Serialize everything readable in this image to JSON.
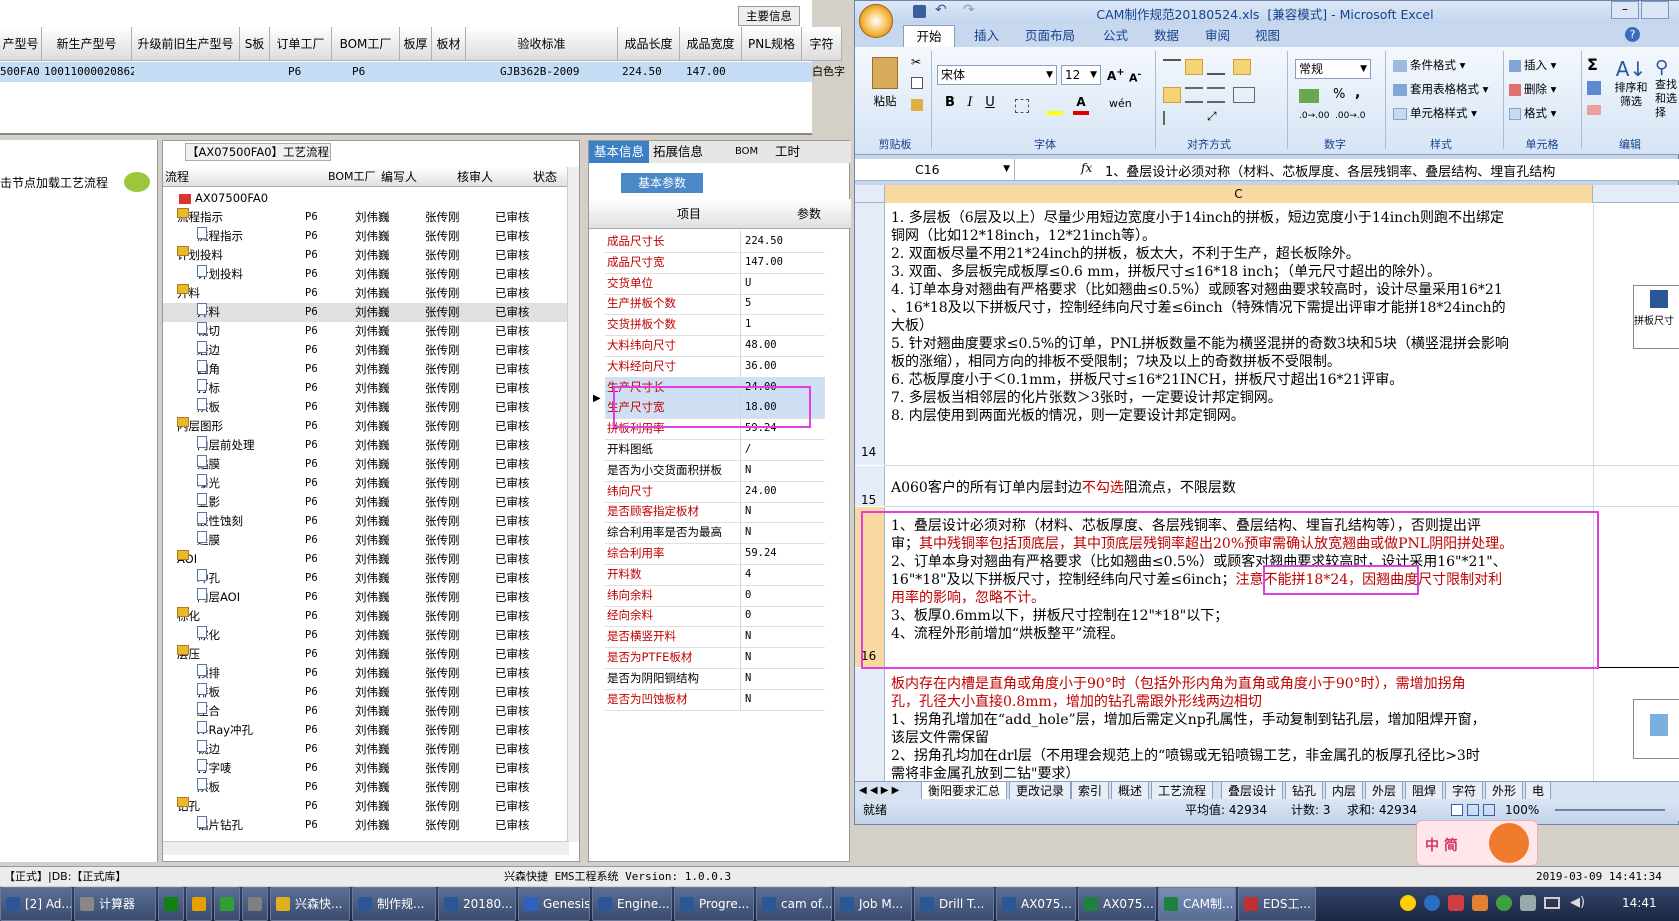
{
  "top_grid": {
    "top_button": "主要信息",
    "headers": [
      "产型号",
      "新生产型号",
      "升级前旧生产型号",
      "S板",
      "订单工厂",
      "BOM工厂",
      "板厚",
      "板材",
      "验收标准",
      "成品长度",
      "成品宽度",
      "PNL规格",
      "字符"
    ],
    "row": [
      "500FA0",
      "10011000020862",
      "",
      "",
      "P6",
      "P6",
      "",
      "",
      "GJB362B-2009",
      "224.50",
      "147.00",
      "",
      "白色字"
    ]
  },
  "left_panel": {
    "hint": "击节点加载工艺流程"
  },
  "process": {
    "title": "【AX07500FA0】工艺流程",
    "headers": [
      "流程",
      "BOM工厂",
      "编写人",
      "核审人",
      "状态"
    ],
    "root": "AX07500FA0",
    "rows": [
      {
        "name": "流程指示",
        "level": 1,
        "f": "P6",
        "w": "刘伟巍",
        "r": "张传刚",
        "s": "已审核"
      },
      {
        "name": "流程指示",
        "level": 2,
        "f": "P6",
        "w": "刘伟巍",
        "r": "张传刚",
        "s": "已审核"
      },
      {
        "name": "计划投料",
        "level": 1,
        "f": "P6",
        "w": "刘伟巍",
        "r": "张传刚",
        "s": "已审核"
      },
      {
        "name": "计划投料",
        "level": 2,
        "f": "P6",
        "w": "刘伟巍",
        "r": "张传刚",
        "s": "已审核"
      },
      {
        "name": "开料",
        "level": 1,
        "f": "P6",
        "w": "刘伟巍",
        "r": "张传刚",
        "s": "已审核"
      },
      {
        "name": "开料",
        "level": 2,
        "f": "P6",
        "w": "刘伟巍",
        "r": "张传刚",
        "s": "已审核"
      },
      {
        "name": "裁切",
        "level": 2,
        "f": "P6",
        "w": "刘伟巍",
        "r": "张传刚",
        "s": "已审核"
      },
      {
        "name": "磨边",
        "level": 2,
        "f": "P6",
        "w": "刘伟巍",
        "r": "张传刚",
        "s": "已审核"
      },
      {
        "name": "圆角",
        "level": 2,
        "f": "P6",
        "w": "刘伟巍",
        "r": "张传刚",
        "s": "已审核"
      },
      {
        "name": "打标",
        "level": 2,
        "f": "P6",
        "w": "刘伟巍",
        "r": "张传刚",
        "s": "已审核"
      },
      {
        "name": "烘板",
        "level": 2,
        "f": "P6",
        "w": "刘伟巍",
        "r": "张传刚",
        "s": "已审核"
      },
      {
        "name": "内层图形",
        "level": 1,
        "f": "P6",
        "w": "刘伟巍",
        "r": "张传刚",
        "s": "已审核"
      },
      {
        "name": "内层前处理",
        "level": 2,
        "f": "P6",
        "w": "刘伟巍",
        "r": "张传刚",
        "s": "已审核"
      },
      {
        "name": "贴膜",
        "level": 2,
        "f": "P6",
        "w": "刘伟巍",
        "r": "张传刚",
        "s": "已审核"
      },
      {
        "name": "曝光",
        "level": 2,
        "f": "P6",
        "w": "刘伟巍",
        "r": "张传刚",
        "s": "已审核"
      },
      {
        "name": "显影",
        "level": 2,
        "f": "P6",
        "w": "刘伟巍",
        "r": "张传刚",
        "s": "已审核"
      },
      {
        "name": "酸性蚀刻",
        "level": 2,
        "f": "P6",
        "w": "刘伟巍",
        "r": "张传刚",
        "s": "已审核"
      },
      {
        "name": "退膜",
        "level": 2,
        "f": "P6",
        "w": "刘伟巍",
        "r": "张传刚",
        "s": "已审核"
      },
      {
        "name": "AOI",
        "level": 1,
        "f": "P6",
        "w": "刘伟巍",
        "r": "张传刚",
        "s": "已审核"
      },
      {
        "name": "冲孔",
        "level": 2,
        "f": "P6",
        "w": "刘伟巍",
        "r": "张传刚",
        "s": "已审核"
      },
      {
        "name": "内层AOI",
        "level": 2,
        "f": "P6",
        "w": "刘伟巍",
        "r": "张传刚",
        "s": "已审核"
      },
      {
        "name": "棕化",
        "level": 1,
        "f": "P6",
        "w": "刘伟巍",
        "r": "张传刚",
        "s": "已审核"
      },
      {
        "name": "棕化",
        "level": 2,
        "f": "P6",
        "w": "刘伟巍",
        "r": "张传刚",
        "s": "已审核"
      },
      {
        "name": "层压",
        "level": 1,
        "f": "P6",
        "w": "刘伟巍",
        "r": "张传刚",
        "s": "已审核"
      },
      {
        "name": "预排",
        "level": 2,
        "f": "P6",
        "w": "刘伟巍",
        "r": "张传刚",
        "s": "已审核"
      },
      {
        "name": "排板",
        "level": 2,
        "f": "P6",
        "w": "刘伟巍",
        "r": "张传刚",
        "s": "已审核"
      },
      {
        "name": "压合",
        "level": 2,
        "f": "P6",
        "w": "刘伟巍",
        "r": "张传刚",
        "s": "已审核"
      },
      {
        "name": "X-Ray冲孔",
        "level": 2,
        "f": "P6",
        "w": "刘伟巍",
        "r": "张传刚",
        "s": "已审核"
      },
      {
        "name": "铣边",
        "level": 2,
        "f": "P6",
        "w": "刘伟巍",
        "r": "张传刚",
        "s": "已审核"
      },
      {
        "name": "打字唛",
        "level": 2,
        "f": "P6",
        "w": "刘伟巍",
        "r": "张传刚",
        "s": "已审核"
      },
      {
        "name": "烘板",
        "level": 2,
        "f": "P6",
        "w": "刘伟巍",
        "r": "张传刚",
        "s": "已审核"
      },
      {
        "name": "钻孔",
        "level": 1,
        "f": "P6",
        "w": "刘伟巍",
        "r": "张传刚",
        "s": "已审核"
      },
      {
        "name": "铝片钻孔",
        "level": 2,
        "f": "P6",
        "w": "刘伟巍",
        "r": "张传刚",
        "s": "已审核"
      }
    ]
  },
  "params": {
    "tabs": [
      "基本信息",
      "拓展信息",
      "BOM",
      "工时"
    ],
    "subtab": "基本参数",
    "col_item": "项目",
    "col_value": "参数",
    "rows": [
      {
        "name": "成品尺寸长",
        "value": "224.50",
        "red": true
      },
      {
        "name": "成品尺寸宽",
        "value": "147.00",
        "red": true
      },
      {
        "name": "交货单位",
        "value": "U",
        "red": true
      },
      {
        "name": "生产拼板个数",
        "value": "5",
        "red": true
      },
      {
        "name": "交货拼板个数",
        "value": "1",
        "red": true
      },
      {
        "name": "大料纬向尺寸",
        "value": "48.00",
        "red": true
      },
      {
        "name": "大料经向尺寸",
        "value": "36.00",
        "red": true
      },
      {
        "name": "生产尺寸长",
        "value": "24.00",
        "red": true
      },
      {
        "name": "生产尺寸宽",
        "value": "18.00",
        "red": true
      },
      {
        "name": "拼板利用率",
        "value": "59.24",
        "red": true
      },
      {
        "name": "开料图纸",
        "value": "/",
        "red": false
      },
      {
        "name": "是否为小交货面积拼板",
        "value": "N",
        "red": false
      },
      {
        "name": "纬向尺寸",
        "value": "24.00",
        "red": true
      },
      {
        "name": "是否顾客指定板材",
        "value": "N",
        "red": true
      },
      {
        "name": "综合利用率是否为最高",
        "value": "N",
        "red": false
      },
      {
        "name": "综合利用率",
        "value": "59.24",
        "red": true
      },
      {
        "name": "开料数",
        "value": "4",
        "red": true
      },
      {
        "name": "纬向余料",
        "value": "0",
        "red": true
      },
      {
        "name": "经向余料",
        "value": "0",
        "red": true
      },
      {
        "name": "是否横竖开料",
        "value": "N",
        "red": true
      },
      {
        "name": "是否为PTFE板材",
        "value": "N",
        "red": true
      },
      {
        "name": "是否为阴阳铜结构",
        "value": "N",
        "red": false
      },
      {
        "name": "是否为凹蚀板材",
        "value": "N",
        "red": true
      }
    ]
  },
  "status_bar": {
    "left": "【正式】|DB:【正式库】",
    "center": "兴森快捷 EMS工程系统 Version: 1.0.0.3",
    "datetime": "2019-03-09 14:41:34"
  },
  "excel": {
    "title": "CAM制作规范20180524.xls  [兼容模式] - Microsoft Excel",
    "ribbon_tabs": [
      "开始",
      "插入",
      "页面布局",
      "公式",
      "数据",
      "审阅",
      "视图"
    ],
    "font_name": "宋体",
    "font_size": "12",
    "number_format": "常规",
    "group_labels": [
      "剪贴板",
      "字体",
      "对齐方式",
      "数字",
      "样式",
      "单元格",
      "编辑"
    ],
    "paste_label": "粘贴",
    "styles": [
      "条件格式",
      "套用表格格式",
      "单元格样式"
    ],
    "cells_btns": [
      "插入",
      "删除",
      "格式"
    ],
    "edit_btns": [
      "排序和筛选",
      "查找和选择"
    ],
    "name_box": "C16",
    "fx": "fx",
    "formula": "1、叠层设计必须对称（材料、芯板厚度、各层残铜率、叠层结构、埋盲孔结构",
    "col_header": "C",
    "row_block1": [
      "1. 多层板（6层及以上）尽量少用短边宽度小于14inch的拼板，短边宽度小于14inch则跑不出绑定",
      "铜网（比如12*18inch，12*21inch等）。",
      "2. 双面板尽量不用21*24inch的拼板，板太大，不利于生产，超长板除外。",
      "3. 双面、多层板完成板厚≤0.6 mm，拼板尺寸≤16*18 inch；（单元尺寸超出的除外）。",
      "4. 订单本身对翘曲有严格要求（比如翘曲≤0.5%）或顾客对翘曲要求较高时，设计尽量采用16*21",
      "、16*18及以下拼板尺寸，控制经纬向尺寸差≤6inch（特殊情况下需提出评审才能拼18*24inch的",
      "大板）",
      "5. 针对翘曲度要求≤0.5%的订单，PNL拼板数量不能为横竖混拼的奇数3块和5块（横竖混拼会影响",
      "板的涨缩），相同方向的排板不受限制；7块及以上的奇数拼板不受限制。",
      "6. 芯板厚度小于＜0.1mm，拼板尺寸≤16*21INCH，拼板尺寸超出16*21评审。",
      "7. 多层板当相邻层的化片张数＞3张时，一定要设计邦定铜网。",
      "8. 内层使用到两面光板的情况，则一定要设计邦定铜网。"
    ],
    "row14": "14",
    "row15": "15",
    "row16": "16",
    "row15_a": "A060客户的所有订单内层封边",
    "row15_b": "不勾选",
    "row15_c": "阻流点，不限层数",
    "row16_l1": "1、叠层设计必须对称（材料、芯板厚度、各层残铜率、叠层结构、埋盲孔结构等），否则提出评",
    "row16_l2a": "审；",
    "row16_l2b": "其中残铜率包括顶底层，其中顶底层残铜率超出20%预审需确认放宽翘曲或做PNL阴阳拼处理。",
    "row16_l3": "2、订单本身对翘曲有严格要求（比如翘曲≤0.5%）或顾客对翘曲要求较高时，设计采用16\"*21\"、",
    "row16_l4a": "16\"*18\"及以下拼板尺寸，控制经纬向尺寸差≤6inch；",
    "row16_l4b": "注意不能拼18*24，",
    "row16_l4c": "因翘曲度尺寸限制对利",
    "row16_l5": "用率的影响，忽略不计。",
    "row16_l6": "3、板厚0.6mm以下，拼板尺寸控制在12\"*18\"以下；",
    "row16_l7": "4、流程外形前增加“烘板整平”流程。",
    "row17_l1": "板内存在内槽是直角或角度小于90°时（包括外形内角为直角或角度小于90°时），需增加拐角",
    "row17_l2": "孔，孔径大小直接0.8mm，增加的钻孔需跟外形线两边相切",
    "row17_l3": "1、拐角孔增加在“add_hole”层，增加后需定义np孔属性，手动复制到钻孔层，增加阻焊开窗，",
    "row17_l4": "该层文件需保留",
    "row17_l5": "2、拐角孔均加在drl层（不用理会规范上的“喷锡或无铅喷锡工艺，非金属孔的板厚孔径比>3时",
    "row17_l6": "需将非金属孔放到二钻\"要求）",
    "side_note": "拼板尺寸",
    "sheet_tabs": [
      "衡阳要求汇总",
      "更改记录",
      "索引",
      "概述",
      "工艺流程",
      "叠层设计",
      "钻孔",
      "内层",
      "外层",
      "阻焊",
      "字符",
      "外形",
      "电"
    ],
    "status_ready": "就绪",
    "status_avg": "平均值: 42934",
    "status_count": "计数: 3",
    "status_sum": "求和: 42934",
    "zoom": "100%"
  },
  "ime": {
    "text": "中 简"
  },
  "taskbar": {
    "items": [
      "[2] Ad...",
      "计算器",
      "",
      "",
      "",
      "",
      "兴森快...",
      "制作规...",
      "20180...",
      "Genesis",
      "Engine...",
      "Progre...",
      "cam of...",
      "Job M...",
      "Drill T...",
      "AX075...",
      "AX075...",
      "CAM制...",
      "EDS工..."
    ],
    "clock": "14:41"
  }
}
